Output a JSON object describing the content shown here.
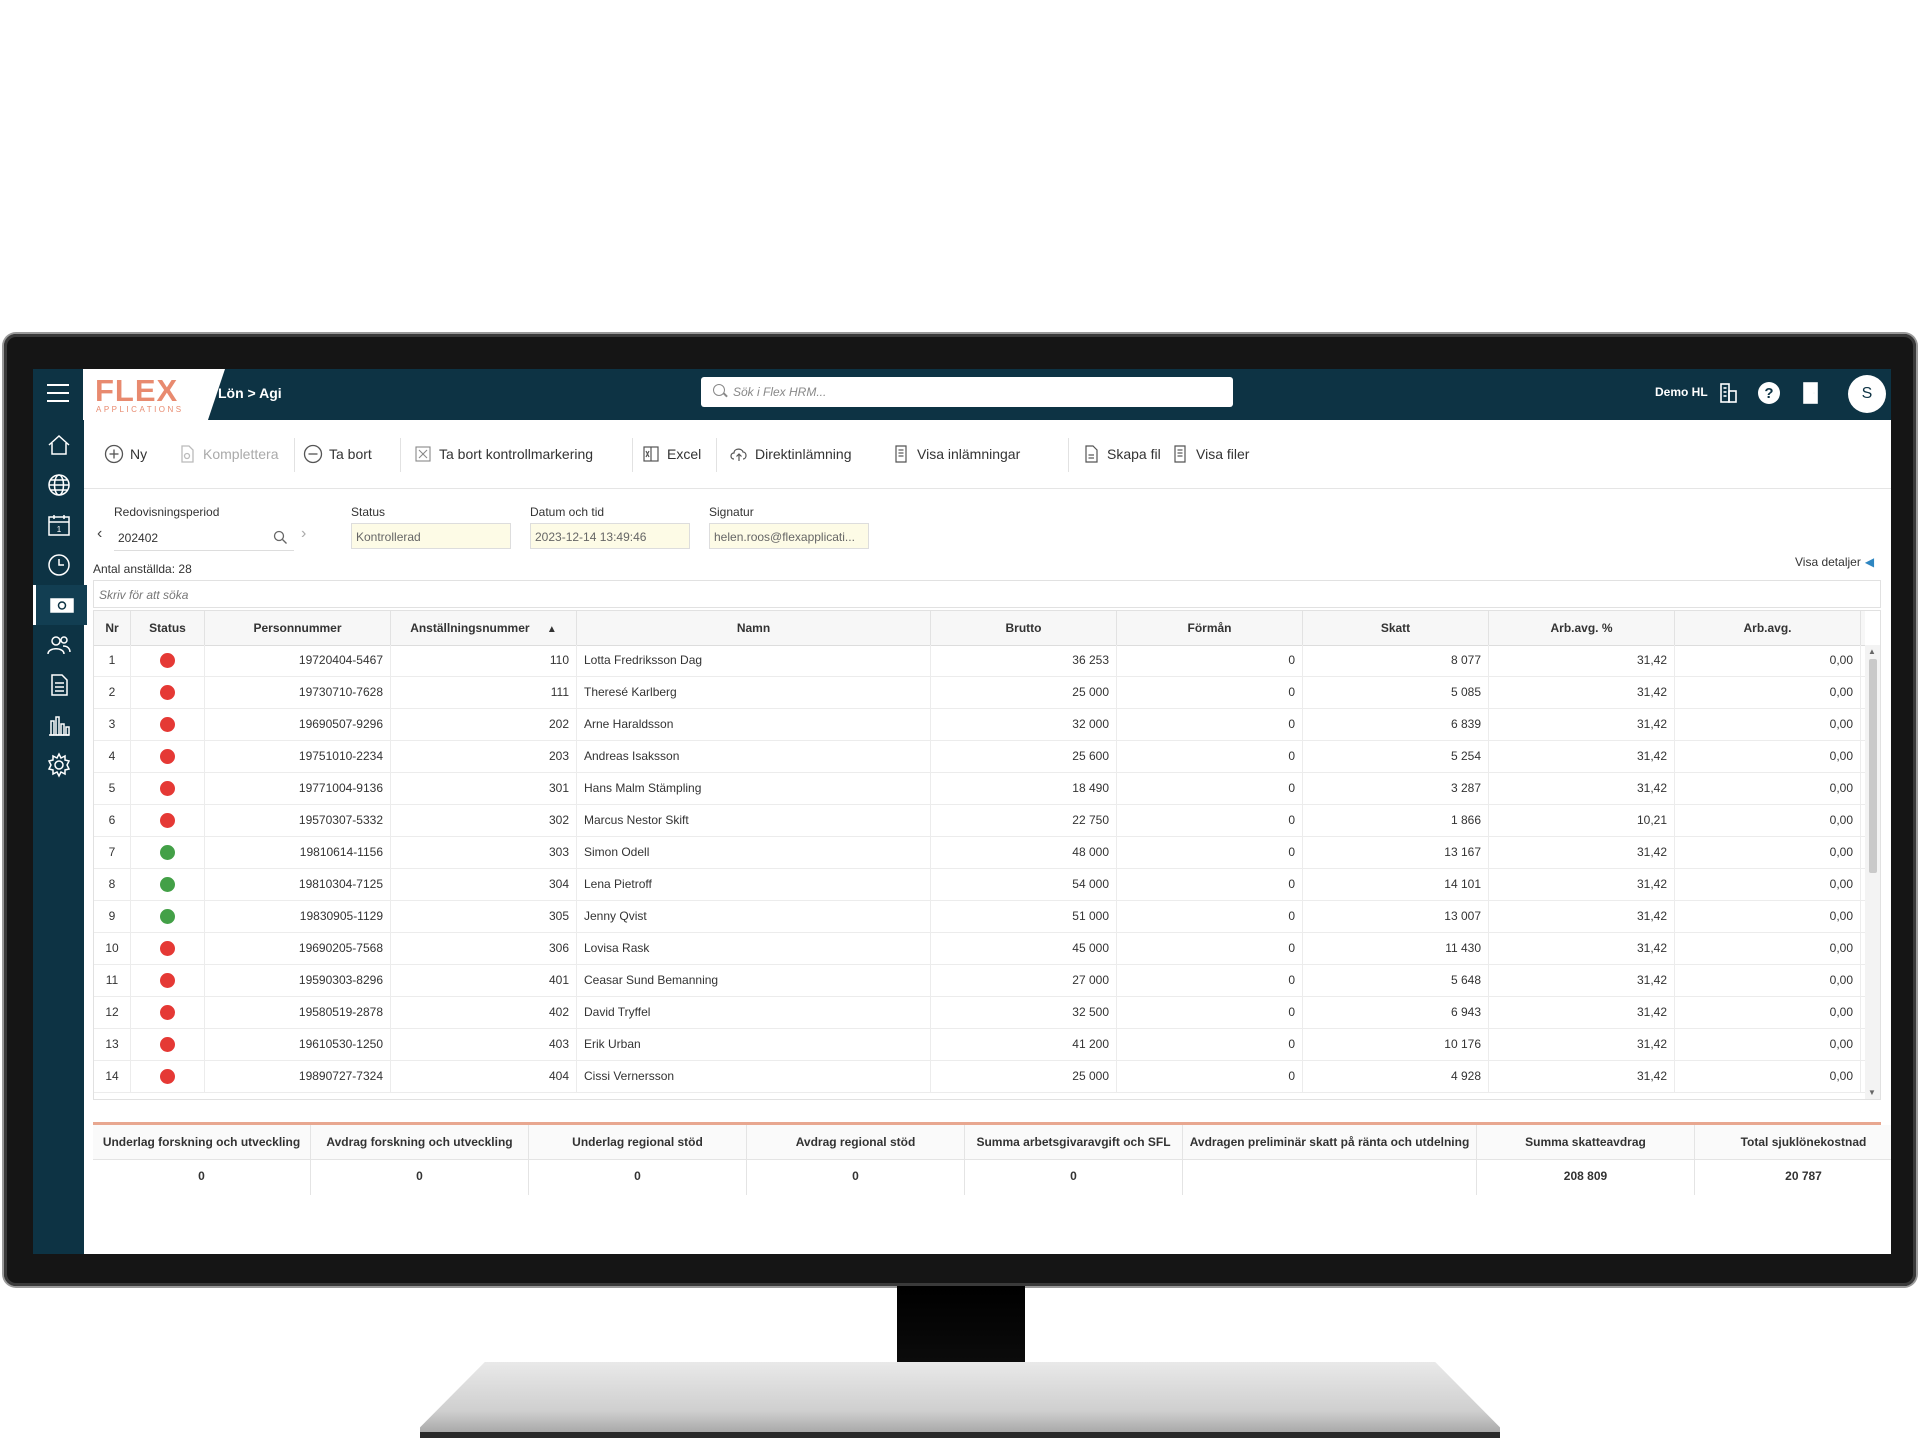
{
  "app": {
    "logo_main": "FLEX",
    "logo_sub": "APPLICATIONS",
    "breadcrumb": "Lön > Agi",
    "search_placeholder": "Sök i Flex HRM...",
    "user": "Demo HL",
    "avatar_letter": "S"
  },
  "sidebar": {
    "items": [
      "home-icon",
      "globe-icon",
      "calendar-icon",
      "clock-icon",
      "payroll-icon",
      "people-icon",
      "document-icon",
      "chart-icon",
      "settings-icon"
    ],
    "active_index": 4
  },
  "toolbar": {
    "ny": "Ny",
    "komplettera": "Komplettera",
    "ta_bort": "Ta bort",
    "ta_bort_kontroll": "Ta bort kontrollmarkering",
    "excel": "Excel",
    "direkt": "Direktinlämning",
    "visa_inl": "Visa inlämningar",
    "skapa_fil": "Skapa fil",
    "visa_filer": "Visa filer"
  },
  "filters": {
    "period_label": "Redovisningsperiod",
    "period_value": "202402",
    "status_label": "Status",
    "status_value": "Kontrollerad",
    "datetime_label": "Datum och tid",
    "datetime_value": "2023-12-14 13:49:46",
    "signature_label": "Signatur",
    "signature_value": "helen.roos@flexapplicati..."
  },
  "employee_count": "Antal anställda: 28",
  "visa_detaljer": "Visa detaljer",
  "table_search_placeholder": "Skriv för att söka",
  "table": {
    "headers": {
      "nr": "Nr",
      "status": "Status",
      "personnummer": "Personnummer",
      "anstnr": "Anställningsnummer",
      "namn": "Namn",
      "brutto": "Brutto",
      "forman": "Förmån",
      "skatt": "Skatt",
      "arbpct": "Arb.avg. %",
      "arbavg": "Arb.avg."
    },
    "rows": [
      {
        "nr": "1",
        "status": "red",
        "pnr": "19720404-5467",
        "anr": "110",
        "namn": "Lotta Fredriksson Dag",
        "brutto": "36 253",
        "forman": "0",
        "skatt": "8 077",
        "pct": "31,42",
        "arb": "0,00"
      },
      {
        "nr": "2",
        "status": "red",
        "pnr": "19730710-7628",
        "anr": "111",
        "namn": "Theresé Karlberg",
        "brutto": "25 000",
        "forman": "0",
        "skatt": "5 085",
        "pct": "31,42",
        "arb": "0,00"
      },
      {
        "nr": "3",
        "status": "red",
        "pnr": "19690507-9296",
        "anr": "202",
        "namn": "Arne Haraldsson",
        "brutto": "32 000",
        "forman": "0",
        "skatt": "6 839",
        "pct": "31,42",
        "arb": "0,00"
      },
      {
        "nr": "4",
        "status": "red",
        "pnr": "19751010-2234",
        "anr": "203",
        "namn": "Andreas Isaksson",
        "brutto": "25 600",
        "forman": "0",
        "skatt": "5 254",
        "pct": "31,42",
        "arb": "0,00"
      },
      {
        "nr": "5",
        "status": "red",
        "pnr": "19771004-9136",
        "anr": "301",
        "namn": "Hans Malm Stämpling",
        "brutto": "18 490",
        "forman": "0",
        "skatt": "3 287",
        "pct": "31,42",
        "arb": "0,00"
      },
      {
        "nr": "6",
        "status": "red",
        "pnr": "19570307-5332",
        "anr": "302",
        "namn": "Marcus Nestor Skift",
        "brutto": "22 750",
        "forman": "0",
        "skatt": "1 866",
        "pct": "10,21",
        "arb": "0,00"
      },
      {
        "nr": "7",
        "status": "green",
        "pnr": "19810614-1156",
        "anr": "303",
        "namn": "Simon Odell",
        "brutto": "48 000",
        "forman": "0",
        "skatt": "13 167",
        "pct": "31,42",
        "arb": "0,00"
      },
      {
        "nr": "8",
        "status": "green",
        "pnr": "19810304-7125",
        "anr": "304",
        "namn": "Lena Pietroff",
        "brutto": "54 000",
        "forman": "0",
        "skatt": "14 101",
        "pct": "31,42",
        "arb": "0,00"
      },
      {
        "nr": "9",
        "status": "green",
        "pnr": "19830905-1129",
        "anr": "305",
        "namn": "Jenny Qvist",
        "brutto": "51 000",
        "forman": "0",
        "skatt": "13 007",
        "pct": "31,42",
        "arb": "0,00"
      },
      {
        "nr": "10",
        "status": "red",
        "pnr": "19690205-7568",
        "anr": "306",
        "namn": "Lovisa Rask",
        "brutto": "45 000",
        "forman": "0",
        "skatt": "11 430",
        "pct": "31,42",
        "arb": "0,00"
      },
      {
        "nr": "11",
        "status": "red",
        "pnr": "19590303-8296",
        "anr": "401",
        "namn": "Ceasar Sund Bemanning",
        "brutto": "27 000",
        "forman": "0",
        "skatt": "5 648",
        "pct": "31,42",
        "arb": "0,00"
      },
      {
        "nr": "12",
        "status": "red",
        "pnr": "19580519-2878",
        "anr": "402",
        "namn": "David Tryffel",
        "brutto": "32 500",
        "forman": "0",
        "skatt": "6 943",
        "pct": "31,42",
        "arb": "0,00"
      },
      {
        "nr": "13",
        "status": "red",
        "pnr": "19610530-1250",
        "anr": "403",
        "namn": "Erik Urban",
        "brutto": "41 200",
        "forman": "0",
        "skatt": "10 176",
        "pct": "31,42",
        "arb": "0,00"
      },
      {
        "nr": "14",
        "status": "red",
        "pnr": "19890727-7324",
        "anr": "404",
        "namn": "Cissi Vernersson",
        "brutto": "25 000",
        "forman": "0",
        "skatt": "4 928",
        "pct": "31,42",
        "arb": "0,00"
      }
    ]
  },
  "summary": [
    {
      "label": "Underlag forskning och utveckling",
      "value": "0"
    },
    {
      "label": "Avdrag forskning och utveckling",
      "value": "0"
    },
    {
      "label": "Underlag regional stöd",
      "value": "0"
    },
    {
      "label": "Avdrag regional stöd",
      "value": "0"
    },
    {
      "label": "Summa arbetsgivaravgift och SFL",
      "value": "0"
    },
    {
      "label": "Avdragen preliminär skatt på ränta och utdelning",
      "value": ""
    },
    {
      "label": "Summa skatteavdrag",
      "value": "208 809"
    },
    {
      "label": "Total sjuklönekostnad",
      "value": "20 787"
    }
  ],
  "colors": {
    "topbar": "#0d3344",
    "logo": "#e88a6f",
    "status_red": "#e53935",
    "status_green": "#43a047",
    "summary_accent": "#e8a790"
  }
}
